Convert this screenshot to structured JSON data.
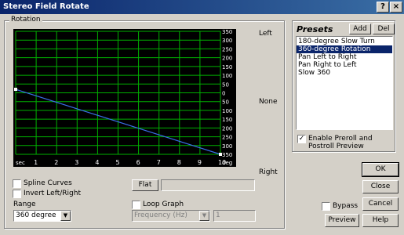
{
  "window": {
    "title": "Stereo Field Rotate"
  },
  "rotation_group": {
    "label": "Rotation"
  },
  "graph": {
    "y_ticks": [
      "350",
      "300",
      "250",
      "200",
      "150",
      "100",
      "50",
      "0",
      "50",
      "100",
      "150",
      "200",
      "250",
      "300",
      "350"
    ],
    "x_start_label": "sec",
    "x_ticks": [
      "1",
      "2",
      "3",
      "4",
      "5",
      "6",
      "7",
      "8",
      "9",
      "10"
    ],
    "x_end_label": "deg",
    "side_left": "Left",
    "side_none": "None",
    "side_right": "Right",
    "line_color": "#3a6ee8",
    "grid_color": "#00b000"
  },
  "spline_curves": {
    "label": "Spline Curves",
    "checked": false
  },
  "invert": {
    "label": "Invert Left/Right",
    "checked": false
  },
  "flat_button": "Flat",
  "range": {
    "label": "Range",
    "value": "360 degree"
  },
  "loop_graph": {
    "label": "Loop Graph",
    "checked": false
  },
  "frequency": {
    "value": "Frequency (Hz)",
    "number": "1"
  },
  "presets": {
    "label": "Presets",
    "add": "Add",
    "del": "Del",
    "items": [
      "180-degree Slow Turn",
      "360-degree Rotation",
      "Pan Left to Right",
      "Pan Right to Left",
      "Slow 360"
    ],
    "selected_index": 1,
    "enable_preroll": {
      "label": "Enable Preroll and Postroll Preview",
      "checked": true
    }
  },
  "buttons": {
    "ok": "OK",
    "close": "Close",
    "cancel": "Cancel",
    "help": "Help",
    "preview": "Preview"
  },
  "bypass": {
    "label": "Bypass",
    "checked": false
  }
}
